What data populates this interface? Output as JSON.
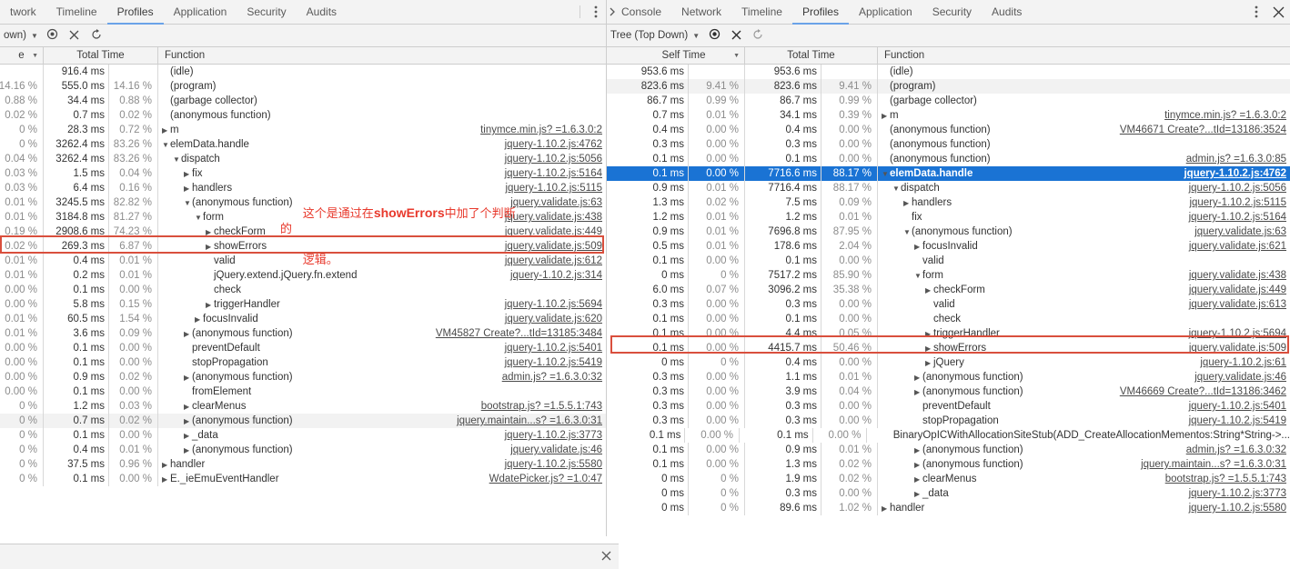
{
  "left_panel": {
    "tabs": [
      {
        "label": "twork",
        "active": false
      },
      {
        "label": "Timeline",
        "active": false
      },
      {
        "label": "Profiles",
        "active": true
      },
      {
        "label": "Application",
        "active": false
      },
      {
        "label": "Security",
        "active": false
      },
      {
        "label": "Audits",
        "active": false
      }
    ],
    "more_icon": "kebab-menu-icon",
    "console_chevron": "console-chevron-icon",
    "toolbar": {
      "view_select": "own)",
      "caret": "▼",
      "focus_icon": "◉",
      "exclude_icon": "✕",
      "restore_icon": "↻"
    },
    "columns": [
      {
        "label": "e",
        "sort": "▼"
      },
      {
        "label": "Total Time",
        "sort": ""
      },
      {
        "label": "Function",
        "sort": ""
      }
    ],
    "rows": [
      {
        "self_pct": "",
        "total_ms": "916.4 ms",
        "total_pct": "",
        "depth": 0,
        "tri": "",
        "name": "(idle)",
        "url": ""
      },
      {
        "self_pct": "14.16 %",
        "total_ms": "555.0 ms",
        "total_pct": "14.16 %",
        "depth": 0,
        "tri": "",
        "name": "(program)",
        "url": ""
      },
      {
        "self_pct": "0.88 %",
        "total_ms": "34.4 ms",
        "total_pct": "0.88 %",
        "depth": 0,
        "tri": "",
        "name": "(garbage collector)",
        "url": ""
      },
      {
        "self_pct": "0.02 %",
        "total_ms": "0.7 ms",
        "total_pct": "0.02 %",
        "depth": 0,
        "tri": "",
        "name": "(anonymous function)",
        "url": ""
      },
      {
        "self_pct": "0 %",
        "total_ms": "28.3 ms",
        "total_pct": "0.72 %",
        "depth": 0,
        "tri": "▶",
        "name": "m",
        "url": "tinymce.min.js? =1.6.3.0:2"
      },
      {
        "self_pct": "0 %",
        "total_ms": "3262.4 ms",
        "total_pct": "83.26 %",
        "depth": 0,
        "tri": "▼",
        "name": "elemData.handle",
        "url": "jquery-1.10.2.js:4762"
      },
      {
        "self_pct": "0.04 %",
        "total_ms": "3262.4 ms",
        "total_pct": "83.26 %",
        "depth": 1,
        "tri": "▼",
        "name": "dispatch",
        "url": "jquery-1.10.2.js:5056"
      },
      {
        "self_pct": "0.03 %",
        "total_ms": "1.5 ms",
        "total_pct": "0.04 %",
        "depth": 2,
        "tri": "▶",
        "name": "fix",
        "url": "jquery-1.10.2.js:5164"
      },
      {
        "self_pct": "0.03 %",
        "total_ms": "6.4 ms",
        "total_pct": "0.16 %",
        "depth": 2,
        "tri": "▶",
        "name": "handlers",
        "url": "jquery-1.10.2.js:5115"
      },
      {
        "self_pct": "0.01 %",
        "total_ms": "3245.5 ms",
        "total_pct": "82.82 %",
        "depth": 2,
        "tri": "▼",
        "name": "(anonymous function)",
        "url": "jquery.validate.js:63"
      },
      {
        "self_pct": "0.01 %",
        "total_ms": "3184.8 ms",
        "total_pct": "81.27 %",
        "depth": 3,
        "tri": "▼",
        "name": "form",
        "url": "jquery.validate.js:438"
      },
      {
        "self_pct": "0.19 %",
        "total_ms": "2908.6 ms",
        "total_pct": "74.23 %",
        "depth": 4,
        "tri": "▶",
        "name": "checkForm",
        "url": "jquery.validate.js:449"
      },
      {
        "self_pct": "0.02 %",
        "total_ms": "269.3 ms",
        "total_pct": "6.87 %",
        "depth": 4,
        "tri": "▶",
        "name": "showErrors",
        "url": "jquery.validate.js:509",
        "highlight": true
      },
      {
        "self_pct": "0.01 %",
        "total_ms": "0.4 ms",
        "total_pct": "0.01 %",
        "depth": 4,
        "tri": "",
        "name": "valid",
        "url": "jquery.validate.js:612"
      },
      {
        "self_pct": "0.01 %",
        "total_ms": "0.2 ms",
        "total_pct": "0.01 %",
        "depth": 4,
        "tri": "",
        "name": "jQuery.extend.jQuery.fn.extend",
        "url": "jquery-1.10.2.js:314"
      },
      {
        "self_pct": "0.00 %",
        "total_ms": "0.1 ms",
        "total_pct": "0.00 %",
        "depth": 4,
        "tri": "",
        "name": "check",
        "url": ""
      },
      {
        "self_pct": "0.00 %",
        "total_ms": "5.8 ms",
        "total_pct": "0.15 %",
        "depth": 4,
        "tri": "▶",
        "name": "triggerHandler",
        "url": "jquery-1.10.2.js:5694"
      },
      {
        "self_pct": "0.01 %",
        "total_ms": "60.5 ms",
        "total_pct": "1.54 %",
        "depth": 3,
        "tri": "▶",
        "name": "focusInvalid",
        "url": "jquery.validate.js:620"
      },
      {
        "self_pct": "0.01 %",
        "total_ms": "3.6 ms",
        "total_pct": "0.09 %",
        "depth": 2,
        "tri": "▶",
        "name": "(anonymous function)",
        "url": "VM45827 Create?...tId=13185:3484"
      },
      {
        "self_pct": "0.00 %",
        "total_ms": "0.1 ms",
        "total_pct": "0.00 %",
        "depth": 2,
        "tri": "",
        "name": "preventDefault",
        "url": "jquery-1.10.2.js:5401"
      },
      {
        "self_pct": "0.00 %",
        "total_ms": "0.1 ms",
        "total_pct": "0.00 %",
        "depth": 2,
        "tri": "",
        "name": "stopPropagation",
        "url": "jquery-1.10.2.js:5419"
      },
      {
        "self_pct": "0.00 %",
        "total_ms": "0.9 ms",
        "total_pct": "0.02 %",
        "depth": 2,
        "tri": "▶",
        "name": "(anonymous function)",
        "url": "admin.js? =1.6.3.0:32"
      },
      {
        "self_pct": "0.00 %",
        "total_ms": "0.1 ms",
        "total_pct": "0.00 %",
        "depth": 2,
        "tri": "",
        "name": "fromElement",
        "url": ""
      },
      {
        "self_pct": "0 %",
        "total_ms": "1.2 ms",
        "total_pct": "0.03 %",
        "depth": 2,
        "tri": "▶",
        "name": "clearMenus",
        "url": "bootstrap.js? =1.5.5.1:743"
      },
      {
        "self_pct": "0 %",
        "total_ms": "0.7 ms",
        "total_pct": "0.02 %",
        "depth": 2,
        "tri": "▶",
        "name": "(anonymous function)",
        "url": "jquery.maintain...s? =1.6.3.0:31",
        "alt": true
      },
      {
        "self_pct": "0 %",
        "total_ms": "0.1 ms",
        "total_pct": "0.00 %",
        "depth": 2,
        "tri": "▶",
        "name": "_data",
        "url": "jquery-1.10.2.js:3773"
      },
      {
        "self_pct": "0 %",
        "total_ms": "0.4 ms",
        "total_pct": "0.01 %",
        "depth": 2,
        "tri": "▶",
        "name": "(anonymous function)",
        "url": "jquery.validate.js:46"
      },
      {
        "self_pct": "0 %",
        "total_ms": "37.5 ms",
        "total_pct": "0.96 %",
        "depth": 0,
        "tri": "▶",
        "name": "handler",
        "url": "jquery-1.10.2.js:5580"
      },
      {
        "self_pct": "0 %",
        "total_ms": "0.1 ms",
        "total_pct": "0.00 %",
        "depth": 0,
        "tri": "▶",
        "name": "E._ieEmuEventHandler",
        "url": "WdatePicker.js? =1.0:47"
      }
    ],
    "drawer_close": "✕"
  },
  "right_panel": {
    "tabs": [
      {
        "label": "Console",
        "active": false
      },
      {
        "label": "Network",
        "active": false
      },
      {
        "label": "Timeline",
        "active": false
      },
      {
        "label": "Profiles",
        "active": true
      },
      {
        "label": "Application",
        "active": false
      },
      {
        "label": "Security",
        "active": false
      },
      {
        "label": "Audits",
        "active": false
      }
    ],
    "more_icon": "kebab-menu-icon",
    "close_icon": "✕",
    "toolbar": {
      "view_select": "Tree (Top Down)",
      "caret": "▼",
      "focus_icon": "◉",
      "exclude_icon": "✕",
      "restore_icon": "↻"
    },
    "columns": [
      {
        "label": "Self Time",
        "sort": "▼"
      },
      {
        "label": "Total Time",
        "sort": ""
      },
      {
        "label": "Function",
        "sort": ""
      }
    ],
    "rows": [
      {
        "self_ms": "953.6 ms",
        "self_pct": "",
        "total_ms": "953.6 ms",
        "total_pct": "",
        "depth": 0,
        "tri": "",
        "name": "(idle)",
        "url": ""
      },
      {
        "self_ms": "823.6 ms",
        "self_pct": "9.41 %",
        "total_ms": "823.6 ms",
        "total_pct": "9.41 %",
        "depth": 0,
        "tri": "",
        "name": "(program)",
        "url": "",
        "alt": true
      },
      {
        "self_ms": "86.7 ms",
        "self_pct": "0.99 %",
        "total_ms": "86.7 ms",
        "total_pct": "0.99 %",
        "depth": 0,
        "tri": "",
        "name": "(garbage collector)",
        "url": ""
      },
      {
        "self_ms": "0.7 ms",
        "self_pct": "0.01 %",
        "total_ms": "34.1 ms",
        "total_pct": "0.39 %",
        "depth": 0,
        "tri": "▶",
        "name": "m",
        "url": "tinymce.min.js? =1.6.3.0:2"
      },
      {
        "self_ms": "0.4 ms",
        "self_pct": "0.00 %",
        "total_ms": "0.4 ms",
        "total_pct": "0.00 %",
        "depth": 0,
        "tri": "",
        "name": "(anonymous function)",
        "url": "VM46671 Create?...tId=13186:3524"
      },
      {
        "self_ms": "0.3 ms",
        "self_pct": "0.00 %",
        "total_ms": "0.3 ms",
        "total_pct": "0.00 %",
        "depth": 0,
        "tri": "",
        "name": "(anonymous function)",
        "url": ""
      },
      {
        "self_ms": "0.1 ms",
        "self_pct": "0.00 %",
        "total_ms": "0.1 ms",
        "total_pct": "0.00 %",
        "depth": 0,
        "tri": "",
        "name": "(anonymous function)",
        "url": "admin.js? =1.6.3.0:85"
      },
      {
        "self_ms": "0.1 ms",
        "self_pct": "0.00 %",
        "total_ms": "7716.6 ms",
        "total_pct": "88.17 %",
        "depth": 0,
        "tri": "▼",
        "name": "elemData.handle",
        "url": "jquery-1.10.2.js:4762",
        "selected": true
      },
      {
        "self_ms": "0.9 ms",
        "self_pct": "0.01 %",
        "total_ms": "7716.4 ms",
        "total_pct": "88.17 %",
        "depth": 1,
        "tri": "▼",
        "name": "dispatch",
        "url": "jquery-1.10.2.js:5056"
      },
      {
        "self_ms": "1.3 ms",
        "self_pct": "0.02 %",
        "total_ms": "7.5 ms",
        "total_pct": "0.09 %",
        "depth": 2,
        "tri": "▶",
        "name": "handlers",
        "url": "jquery-1.10.2.js:5115"
      },
      {
        "self_ms": "1.2 ms",
        "self_pct": "0.01 %",
        "total_ms": "1.2 ms",
        "total_pct": "0.01 %",
        "depth": 2,
        "tri": "",
        "name": "fix",
        "url": "jquery-1.10.2.js:5164"
      },
      {
        "self_ms": "0.9 ms",
        "self_pct": "0.01 %",
        "total_ms": "7696.8 ms",
        "total_pct": "87.95 %",
        "depth": 2,
        "tri": "▼",
        "name": "(anonymous function)",
        "url": "jquery.validate.js:63"
      },
      {
        "self_ms": "0.5 ms",
        "self_pct": "0.01 %",
        "total_ms": "178.6 ms",
        "total_pct": "2.04 %",
        "depth": 3,
        "tri": "▶",
        "name": "focusInvalid",
        "url": "jquery.validate.js:621"
      },
      {
        "self_ms": "0.1 ms",
        "self_pct": "0.00 %",
        "total_ms": "0.1 ms",
        "total_pct": "0.00 %",
        "depth": 3,
        "tri": "",
        "name": "valid",
        "url": ""
      },
      {
        "self_ms": "0 ms",
        "self_pct": "0 %",
        "total_ms": "7517.2 ms",
        "total_pct": "85.90 %",
        "depth": 3,
        "tri": "▼",
        "name": "form",
        "url": "jquery.validate.js:438"
      },
      {
        "self_ms": "6.0 ms",
        "self_pct": "0.07 %",
        "total_ms": "3096.2 ms",
        "total_pct": "35.38 %",
        "depth": 4,
        "tri": "▶",
        "name": "checkForm",
        "url": "jquery.validate.js:449"
      },
      {
        "self_ms": "0.3 ms",
        "self_pct": "0.00 %",
        "total_ms": "0.3 ms",
        "total_pct": "0.00 %",
        "depth": 4,
        "tri": "",
        "name": "valid",
        "url": "jquery.validate.js:613"
      },
      {
        "self_ms": "0.1 ms",
        "self_pct": "0.00 %",
        "total_ms": "0.1 ms",
        "total_pct": "0.00 %",
        "depth": 4,
        "tri": "",
        "name": "check",
        "url": ""
      },
      {
        "self_ms": "0.1 ms",
        "self_pct": "0.00 %",
        "total_ms": "4.4 ms",
        "total_pct": "0.05 %",
        "depth": 4,
        "tri": "▶",
        "name": "triggerHandler",
        "url": "jquery-1.10.2.js:5694"
      },
      {
        "self_ms": "0.1 ms",
        "self_pct": "0.00 %",
        "total_ms": "4415.7 ms",
        "total_pct": "50.46 %",
        "depth": 4,
        "tri": "▶",
        "name": "showErrors",
        "url": "jquery.validate.js:509",
        "highlight": true
      },
      {
        "self_ms": "0 ms",
        "self_pct": "0 %",
        "total_ms": "0.4 ms",
        "total_pct": "0.00 %",
        "depth": 4,
        "tri": "▶",
        "name": "jQuery",
        "url": "jquery-1.10.2.js:61"
      },
      {
        "self_ms": "0.3 ms",
        "self_pct": "0.00 %",
        "total_ms": "1.1 ms",
        "total_pct": "0.01 %",
        "depth": 3,
        "tri": "▶",
        "name": "(anonymous function)",
        "url": "jquery.validate.js:46"
      },
      {
        "self_ms": "0.3 ms",
        "self_pct": "0.00 %",
        "total_ms": "3.9 ms",
        "total_pct": "0.04 %",
        "depth": 3,
        "tri": "▶",
        "name": "(anonymous function)",
        "url": "VM46669 Create?...tId=13186:3462"
      },
      {
        "self_ms": "0.3 ms",
        "self_pct": "0.00 %",
        "total_ms": "0.3 ms",
        "total_pct": "0.00 %",
        "depth": 3,
        "tri": "",
        "name": "preventDefault",
        "url": "jquery-1.10.2.js:5401"
      },
      {
        "self_ms": "0.3 ms",
        "self_pct": "0.00 %",
        "total_ms": "0.3 ms",
        "total_pct": "0.00 %",
        "depth": 3,
        "tri": "",
        "name": "stopPropagation",
        "url": "jquery-1.10.2.js:5419"
      },
      {
        "self_ms": "0.1 ms",
        "self_pct": "0.00 %",
        "total_ms": "0.1 ms",
        "total_pct": "0.00 %",
        "depth": 3,
        "tri": "",
        "name": "BinaryOpICWithAllocationSiteStub(ADD_CreateAllocationMementos:String*String->...",
        "url": ""
      },
      {
        "self_ms": "0.1 ms",
        "self_pct": "0.00 %",
        "total_ms": "0.9 ms",
        "total_pct": "0.01 %",
        "depth": 3,
        "tri": "▶",
        "name": "(anonymous function)",
        "url": "admin.js? =1.6.3.0:32"
      },
      {
        "self_ms": "0.1 ms",
        "self_pct": "0.00 %",
        "total_ms": "1.3 ms",
        "total_pct": "0.02 %",
        "depth": 3,
        "tri": "▶",
        "name": "(anonymous function)",
        "url": "jquery.maintain...s? =1.6.3.0:31"
      },
      {
        "self_ms": "0 ms",
        "self_pct": "0 %",
        "total_ms": "1.9 ms",
        "total_pct": "0.02 %",
        "depth": 3,
        "tri": "▶",
        "name": "clearMenus",
        "url": "bootstrap.js? =1.5.5.1:743"
      },
      {
        "self_ms": "0 ms",
        "self_pct": "0 %",
        "total_ms": "0.3 ms",
        "total_pct": "0.00 %",
        "depth": 3,
        "tri": "▶",
        "name": "_data",
        "url": "jquery-1.10.2.js:3773"
      },
      {
        "self_ms": "0 ms",
        "self_pct": "0 %",
        "total_ms": "89.6 ms",
        "total_pct": "1.02 %",
        "depth": 0,
        "tri": "▶",
        "name": "handler",
        "url": "jquery-1.10.2.js:5580"
      }
    ]
  },
  "annotation": {
    "line1_a": "这个是通过在",
    "line1_b": "showErrors",
    "line1_c": "中加了个判断的",
    "line2": "逻辑。"
  },
  "colors": {
    "highlight_border": "#d94f3d",
    "selection": "#1a73d4",
    "annotation": "#e8392c",
    "tab_active_underline": "#6aa3e8"
  }
}
